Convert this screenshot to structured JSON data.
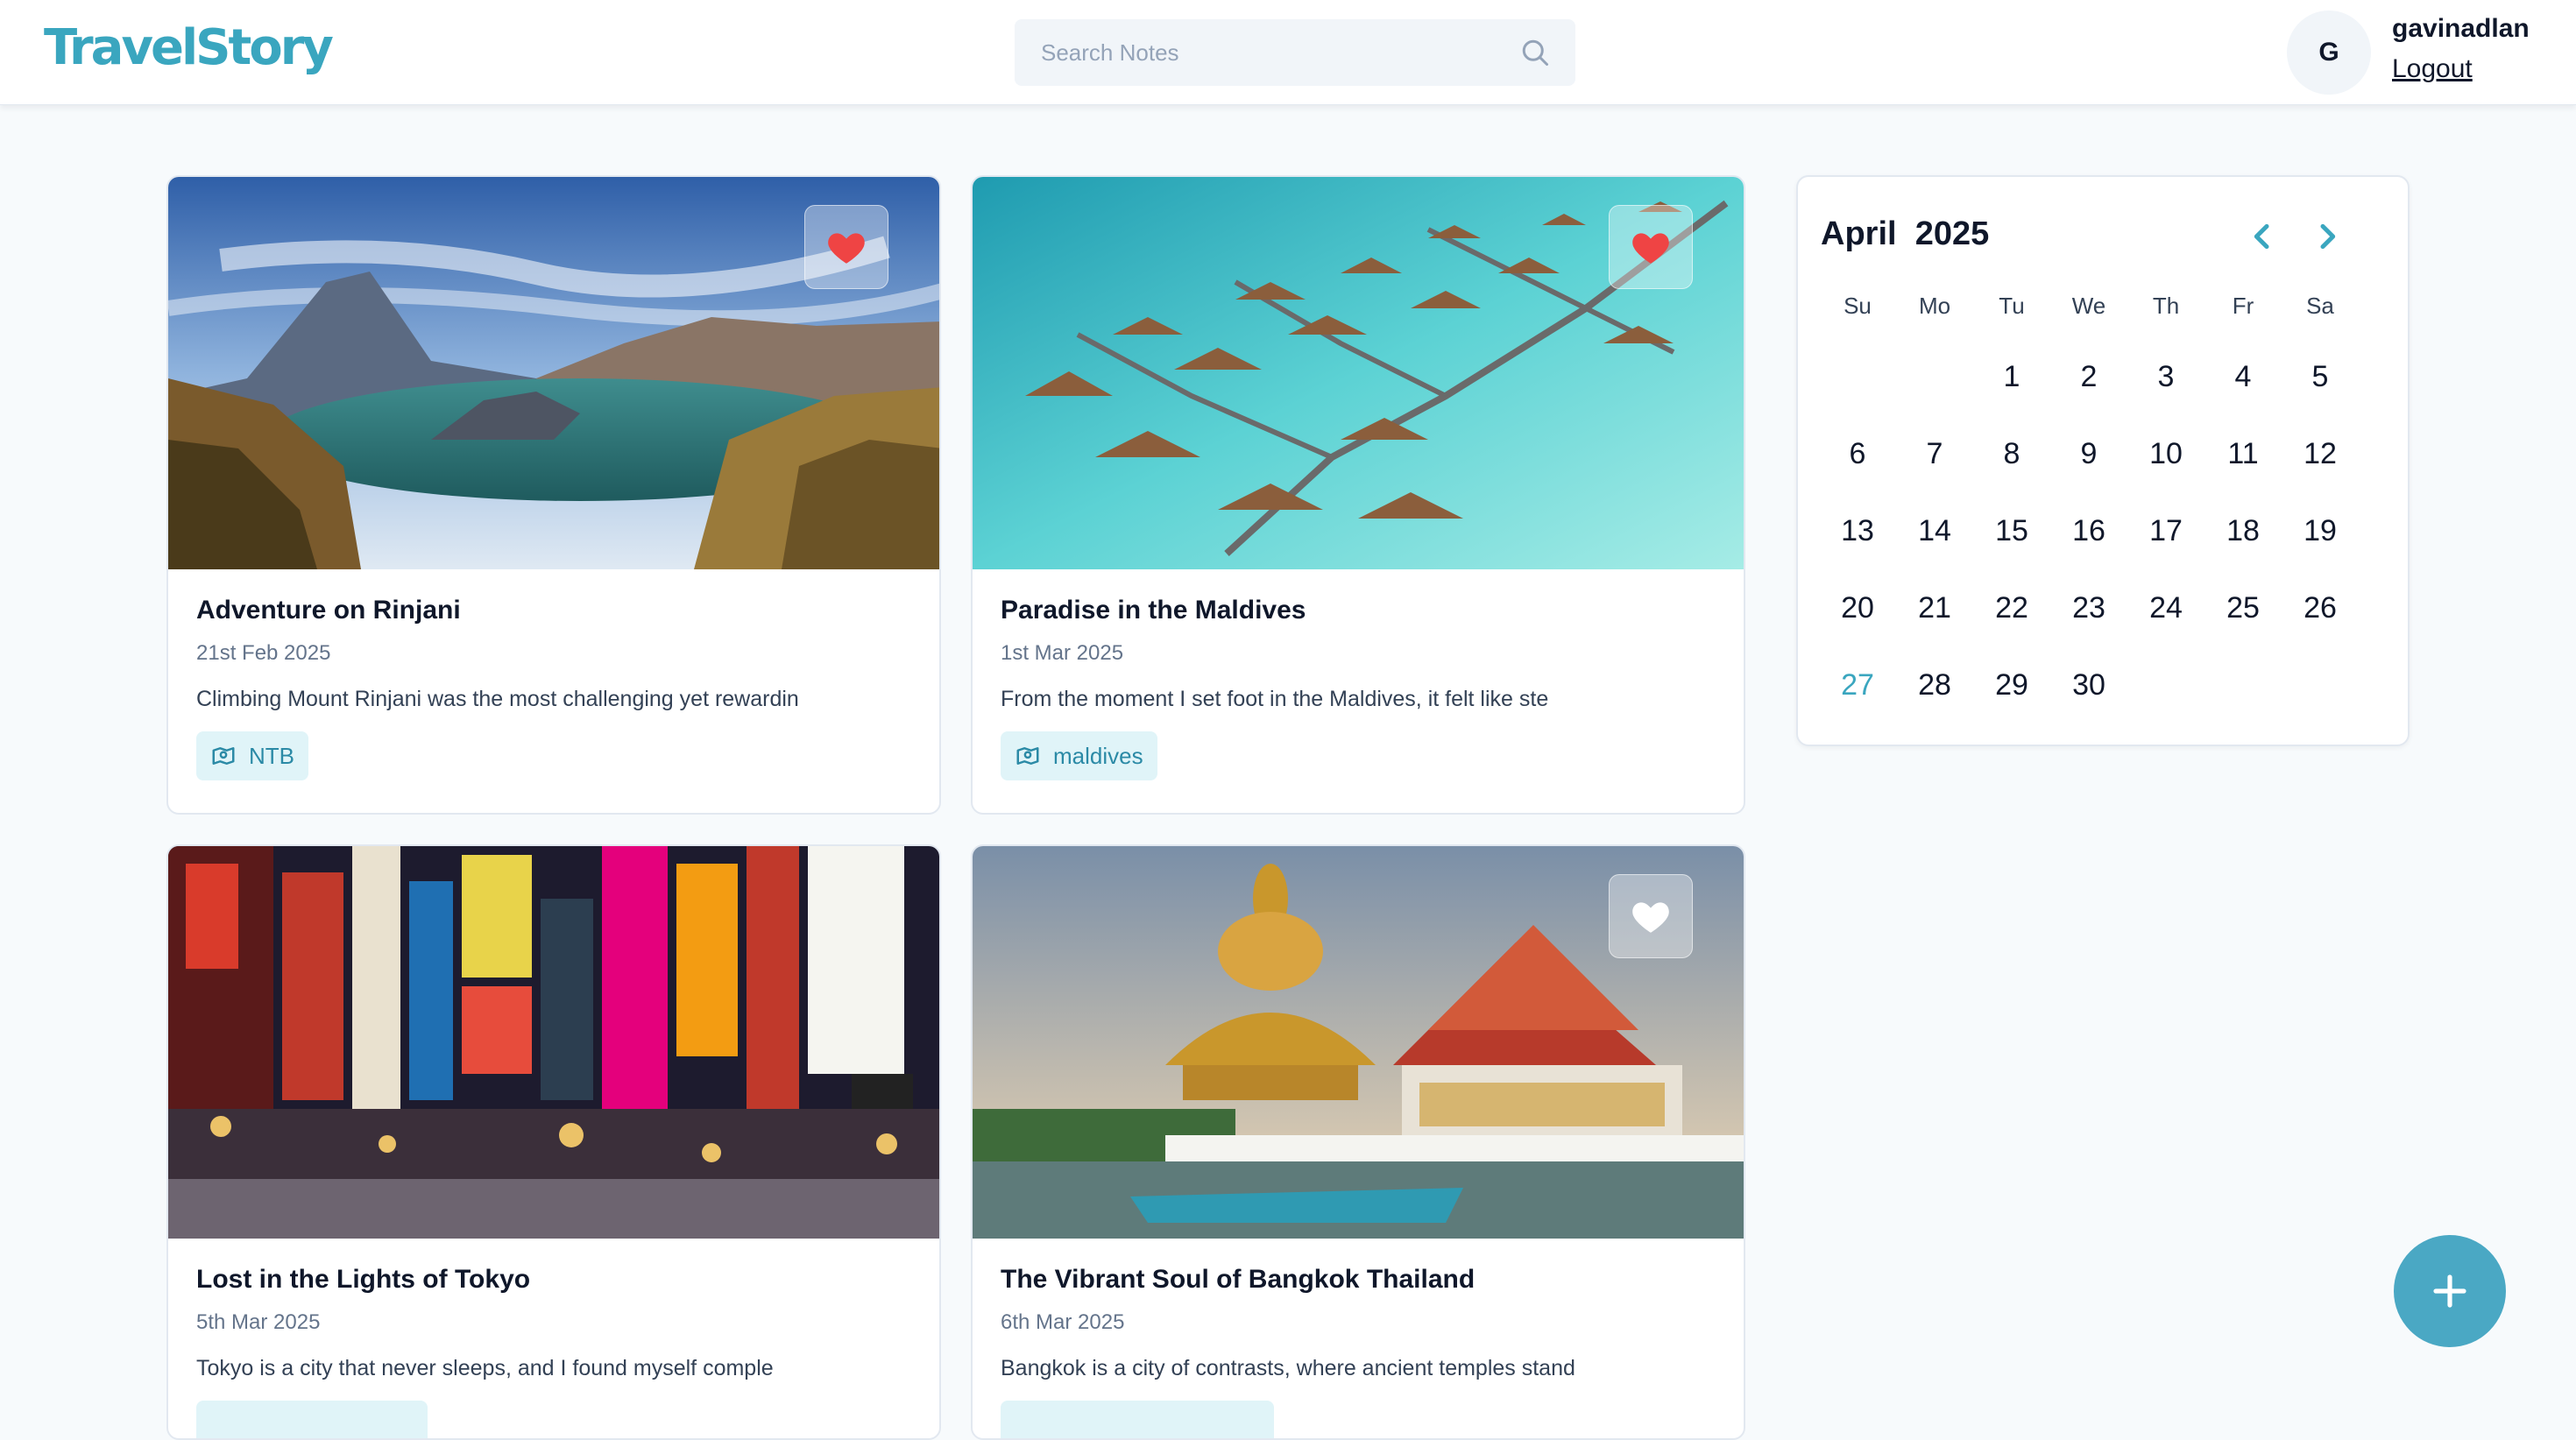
{
  "app": {
    "logo": "TravelStory"
  },
  "search": {
    "placeholder": "Search Notes"
  },
  "user": {
    "initial": "G",
    "name": "gavinadlan",
    "logout_label": "Logout"
  },
  "stories": [
    {
      "title": "Adventure on Rinjani",
      "date": "21st Feb 2025",
      "excerpt": "Climbing Mount Rinjani was the most challenging yet rewardin",
      "tag": "NTB",
      "favorite": true
    },
    {
      "title": "Paradise in the Maldives",
      "date": "1st Mar 2025",
      "excerpt": "From the moment I set foot in the Maldives, it felt like ste",
      "tag": "maldives",
      "favorite": true
    },
    {
      "title": "Lost in the Lights of Tokyo",
      "date": "5th Mar 2025",
      "excerpt": "Tokyo is a city that never sleeps, and I found myself comple",
      "tag": "",
      "favorite": false
    },
    {
      "title": "The Vibrant Soul of Bangkok Thailand",
      "date": "6th Mar 2025",
      "excerpt": "Bangkok is a city of contrasts, where ancient temples stand",
      "tag": "",
      "favorite": false
    }
  ],
  "calendar": {
    "month": "April",
    "year": "2025",
    "weekdays": [
      "Su",
      "Mo",
      "Tu",
      "We",
      "Th",
      "Fr",
      "Sa"
    ],
    "weeks": [
      [
        "",
        "",
        "1",
        "2",
        "3",
        "4",
        "5"
      ],
      [
        "6",
        "7",
        "8",
        "9",
        "10",
        "11",
        "12"
      ],
      [
        "13",
        "14",
        "15",
        "16",
        "17",
        "18",
        "19"
      ],
      [
        "20",
        "21",
        "22",
        "23",
        "24",
        "25",
        "26"
      ],
      [
        "27",
        "28",
        "29",
        "30",
        "",
        "",
        ""
      ]
    ],
    "today": "27"
  },
  "colors": {
    "accent": "#3aa6bf",
    "favorite": "#ef4444",
    "fab": "#4aa8c4"
  },
  "icons": {
    "search": "search-icon",
    "favorite": "heart-icon",
    "tag": "map-location-icon",
    "prev": "chevron-left-icon",
    "next": "chevron-right-icon",
    "add": "plus-icon"
  }
}
